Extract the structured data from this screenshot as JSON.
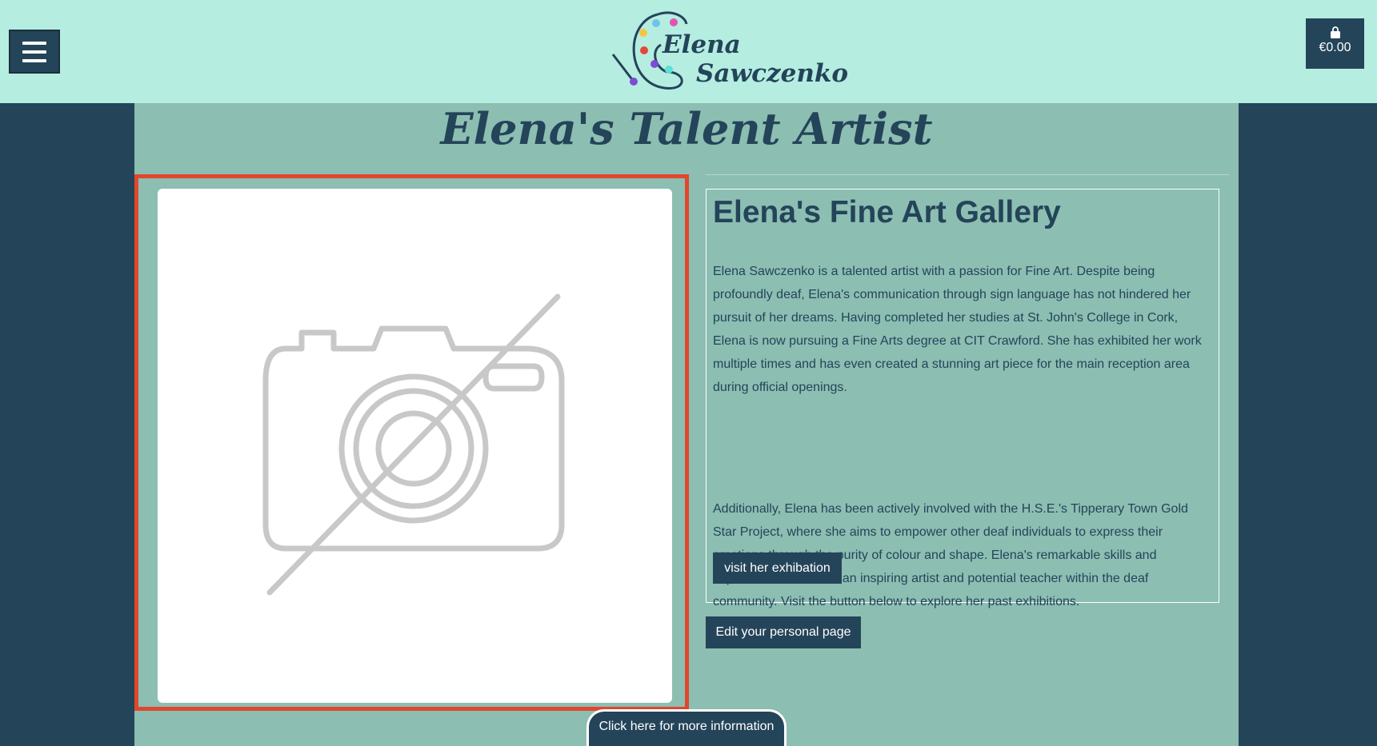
{
  "header": {
    "logo": {
      "line1": "Elena",
      "line2": "Sawczenko"
    },
    "menu_icon": "hamburger-menu-icon",
    "cart": {
      "icon": "shopping-bag-icon",
      "total": "€0.00"
    }
  },
  "main": {
    "page_title": "Elena's Talent Artist",
    "image": {
      "icon": "no-image-camera-icon"
    },
    "gallery": {
      "title": "Elena's Fine Art Gallery",
      "paragraph1": "Elena Sawczenko is a talented artist with a passion for Fine Art. Despite being profoundly deaf, Elena's communication through sign language has not hindered her pursuit of her dreams. Having completed her studies at St. John's College in Cork, Elena is now pursuing a Fine Arts degree at CIT Crawford. She has exhibited her work multiple times and has even created a stunning art piece for the main reception area during official openings.",
      "paragraph2": "Additionally, Elena has been actively involved with the H.S.E.'s Tipperary Town Gold Star Project, where she aims to empower other deaf individuals to express their emotions through the purity of colour and shape. Elena's remarkable skills and experiences make her an inspiring artist and potential teacher within the deaf community. Visit the button below to explore her past exhibitions.",
      "visit_button": "visit her exhibation"
    },
    "edit_button": "Edit your personal page"
  },
  "footer_tab": {
    "label": "Click here for more information"
  },
  "colors": {
    "header_bg": "#b5ede1",
    "page_bg": "#244459",
    "content_bg": "#8cbeb2",
    "primary": "#244459",
    "highlight_border": "#e0472d"
  }
}
